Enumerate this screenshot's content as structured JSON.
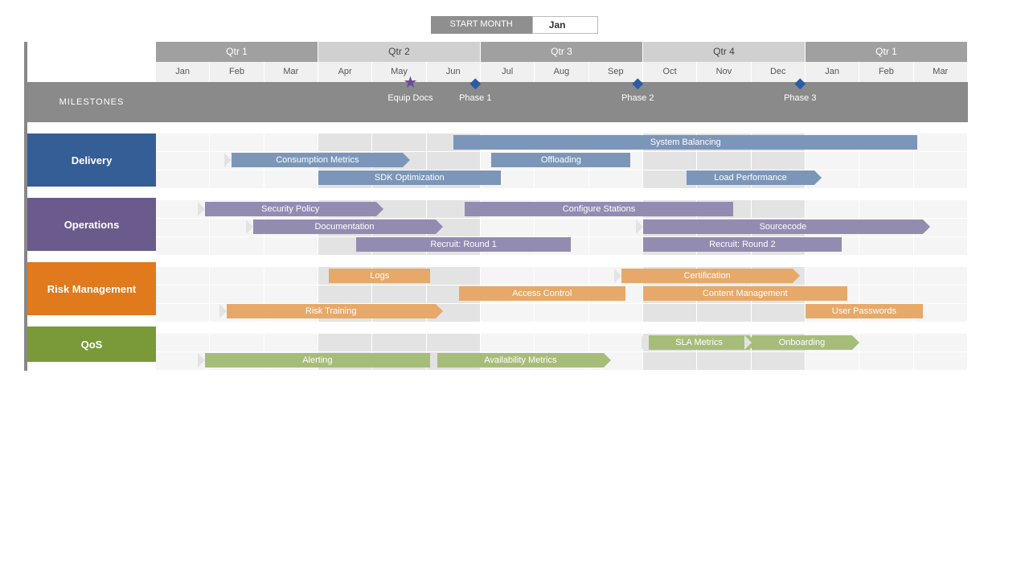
{
  "start_month": {
    "label": "START MONTH",
    "value": "Jan"
  },
  "quarters": [
    "Qtr 1",
    "Qtr 2",
    "Qtr 3",
    "Qtr 4",
    "Qtr 1"
  ],
  "months": [
    "Jan",
    "Feb",
    "Mar",
    "Apr",
    "May",
    "Jun",
    "Jul",
    "Aug",
    "Sep",
    "Oct",
    "Nov",
    "Dec",
    "Jan",
    "Feb",
    "Mar"
  ],
  "shade_pattern": [
    false,
    false,
    false,
    true,
    true,
    true,
    false,
    false,
    false,
    true,
    true,
    true,
    false,
    false,
    false
  ],
  "milestones_label": "MILESTONES",
  "milestones": [
    {
      "label": "Equip Docs",
      "month_index": 4.7,
      "shape": "star"
    },
    {
      "label": "Phase 1",
      "month_index": 5.9,
      "shape": "diamond"
    },
    {
      "label": "Phase 2",
      "month_index": 8.9,
      "shape": "diamond"
    },
    {
      "label": "Phase 3",
      "month_index": 11.9,
      "shape": "diamond"
    }
  ],
  "lanes": [
    {
      "title": "Delivery",
      "color": "delivery",
      "rows": [
        [
          {
            "label": "System Balancing",
            "start": 5.5,
            "span": 8.7,
            "cls": "c-delivery nostartnotch noarrow"
          }
        ],
        [
          {
            "label": "Consumption Metrics",
            "start": 1.4,
            "span": 3.3,
            "cls": "c-delivery"
          },
          {
            "label": "Offloading",
            "start": 6.2,
            "span": 2.7,
            "cls": "c-delivery nostartnotch noarrow"
          }
        ],
        [
          {
            "label": "SDK Optimization",
            "start": 3,
            "span": 3.5,
            "cls": "c-delivery nostartnotch noarrow"
          },
          {
            "label": "Load Performance",
            "start": 9.8,
            "span": 2.5,
            "cls": "c-delivery"
          }
        ]
      ]
    },
    {
      "title": "Operations",
      "color": "ops",
      "rows": [
        [
          {
            "label": "Security Policy",
            "start": 0.9,
            "span": 3.3,
            "cls": "c-ops"
          },
          {
            "label": "Configure Stations",
            "start": 5.7,
            "span": 5.1,
            "cls": "c-ops noarrow nostartnotch"
          }
        ],
        [
          {
            "label": "Documentation",
            "start": 1.8,
            "span": 3.5,
            "cls": "c-ops"
          },
          {
            "label": "Sourcecode",
            "start": 9,
            "span": 5.3,
            "cls": "c-ops"
          }
        ],
        [
          {
            "label": "Recruit: Round 1",
            "start": 3.7,
            "span": 4.1,
            "cls": "c-ops noarrow nostartnotch"
          },
          {
            "label": "Recruit: Round 2",
            "start": 9,
            "span": 3.8,
            "cls": "c-ops noarrow nostartnotch"
          }
        ]
      ]
    },
    {
      "title": "Risk Management",
      "color": "risk",
      "rows": [
        [
          {
            "label": "Logs",
            "start": 3.2,
            "span": 2,
            "cls": "c-risk noarrow nostartnotch"
          },
          {
            "label": "Certification",
            "start": 8.6,
            "span": 3.3,
            "cls": "c-risk"
          }
        ],
        [
          {
            "label": "Access Control",
            "start": 5.6,
            "span": 3.2,
            "cls": "c-risk noarrow nostartnotch"
          },
          {
            "label": "Content Management",
            "start": 9,
            "span": 3.9,
            "cls": "c-risk noarrow nostartnotch"
          }
        ],
        [
          {
            "label": "Risk Training",
            "start": 1.3,
            "span": 4,
            "cls": "c-risk"
          },
          {
            "label": "User Passwords",
            "start": 12,
            "span": 2.3,
            "cls": "c-risk noarrow nostartnotch"
          }
        ]
      ]
    },
    {
      "title": "QoS",
      "color": "qos",
      "rows": [
        [
          {
            "label": "SLA Metrics",
            "start": 9.1,
            "span": 2,
            "cls": "c-qos"
          },
          {
            "label": "Onboarding",
            "start": 11,
            "span": 2,
            "cls": "c-qos"
          }
        ],
        [
          {
            "label": "Alerting",
            "start": 0.9,
            "span": 4.3,
            "cls": "c-qos"
          },
          {
            "label": "Availability Metrics",
            "start": 5.2,
            "span": 3.2,
            "cls": "c-qos"
          }
        ]
      ]
    }
  ]
}
